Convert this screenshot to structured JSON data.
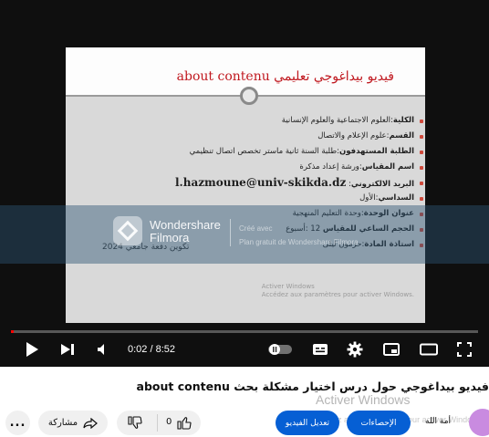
{
  "slide": {
    "title": "فيديو بيداغوجي تعليمي about contenu",
    "items": [
      {
        "label": "الكلية",
        "value": ":العلوم الاجتماعية والعلوم الإنسانية"
      },
      {
        "label": "القسم",
        "value": ":علوم الإعلام والاتصال"
      },
      {
        "label": "الطلبة المستهدفون",
        "value": ":طلبة السنة ثانية ماستر تخصص اتصال تنظيمي"
      },
      {
        "label": "اسم المقياس",
        "value": ":ورشة إعداد مذكرة"
      },
      {
        "label": "البريد الالكتروني",
        "value": ":",
        "email": "l.hazmoune@univ-skikda.dz"
      },
      {
        "label": "السداسي",
        "value": ":الأول"
      },
      {
        "label": "عنوان الوحدة",
        "value": ":وحدة التعليم المنهجية"
      },
      {
        "label": "الحجم الساعي للمقياس",
        "value": "12 :أسبوع"
      },
      {
        "label": "استاذة المادة",
        "value": ":حزمون ليلى"
      }
    ],
    "footer": "تكوين دفعة جامعي 2024",
    "watermark_line1": "Activer Windows",
    "watermark_line2": "Accédez aux paramètres pour activer Windows."
  },
  "watermark": {
    "brand_line1": "Wondershare",
    "brand_line2": "Filmora",
    "note_line1": "Créé avec",
    "note_line2": "Plan gratuit de Wondershare Filmora"
  },
  "player": {
    "time": "0:02 / 8:52",
    "progress": 0.004,
    "accent_color": "#ff0000",
    "controls": [
      "play-icon",
      "next-icon",
      "volume-icon",
      "autoplay-toggle",
      "subtitles-icon",
      "settings-icon",
      "miniplayer-icon",
      "theater-icon",
      "fullscreen-icon"
    ]
  },
  "video": {
    "title": "فيديو بيداغوجي حول درس اختيار مشكلة بحث about contenu",
    "activate_title": "Activer Windows",
    "activate_sub": "Accédez aux paramètres pour activer Windows."
  },
  "actions": {
    "more_label": "...",
    "share_label": "مشاركة",
    "like_count": "0",
    "stats_label": "الإحصاءات",
    "edit_label": "تعديل الفيديو",
    "channel_name": "أمة الله"
  }
}
